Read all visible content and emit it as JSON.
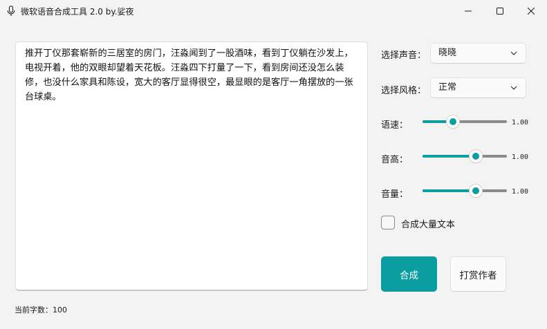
{
  "window": {
    "title": "微软语音合成工具 2.0 by.娑夜",
    "icon": "microphone-icon",
    "controls": [
      "minimize-icon",
      "maximize-icon",
      "close-icon"
    ]
  },
  "editor": {
    "text": "推开丁仪那套崭新的三居室的房门，汪淼闻到了一股酒味，看到丁仪躺在沙发上，电视开着，他的双眼却望着天花板。汪淼四下打量了一下，看到房间还没怎么装修，也没什么家具和陈设，宽大的客厅显得很空，最显眼的是客厅一角摆放的一张台球桌。"
  },
  "settings": {
    "voice": {
      "label": "选择声音：",
      "value": "晓晓"
    },
    "style": {
      "label": "选择风格：",
      "value": "正常"
    },
    "rate": {
      "label": "语速：",
      "value": "1.00",
      "fraction": 0.36
    },
    "pitch": {
      "label": "音高：",
      "value": "1.00",
      "fraction": 0.63
    },
    "volume": {
      "label": "音量：",
      "value": "1.00",
      "fraction": 0.63
    },
    "bulk": {
      "label": "合成大量文本",
      "checked": false
    }
  },
  "actions": {
    "synthesize": "合成",
    "donate": "打赏作者"
  },
  "status": {
    "char_count": "当前字数：100"
  },
  "colors": {
    "accent": "#0a9ea0",
    "background": "#f3f3f3"
  }
}
